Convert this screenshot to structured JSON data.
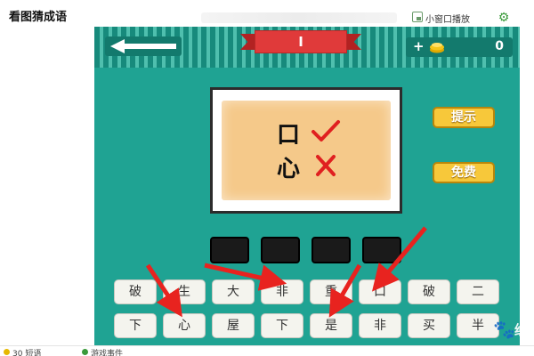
{
  "page": {
    "title": "看图猜成语"
  },
  "window": {
    "mini_window_label": "小窗口播放",
    "mini_window_icon": "mini-window-icon",
    "settings_icon": "gear-icon"
  },
  "game": {
    "back_icon": "arrow-left-icon",
    "level": "I",
    "coins": {
      "plus": "+",
      "count": "0",
      "icon": "coin-icon"
    },
    "clue": {
      "lines": [
        {
          "char": "口",
          "mark": "check"
        },
        {
          "char": "心",
          "mark": "cross"
        }
      ],
      "check_color": "#e02020",
      "cross_color": "#e02020"
    },
    "buttons": {
      "hint": "提示",
      "free": "免费"
    },
    "answer_slots": 4,
    "tiles_row1": [
      "破",
      "生",
      "大",
      "非",
      "重",
      "口",
      "破",
      "二"
    ],
    "tiles_row2": [
      "下",
      "心",
      "屋",
      "下",
      "是",
      "非",
      "买",
      "半"
    ],
    "accent_colors": {
      "board": "#1fa393",
      "ribbon": "#e03a3a",
      "button": "#f7c83a",
      "arrow": "#e8231f"
    }
  },
  "watermark": {
    "brand": "经验",
    "icon": "paw-icon"
  },
  "bottom": {
    "left_text": "30 短语",
    "right_text": "游戏事件"
  }
}
